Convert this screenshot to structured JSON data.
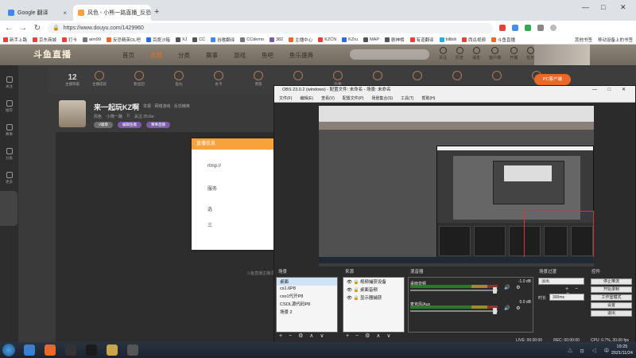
{
  "browser": {
    "tabs": [
      {
        "title": "Google 翻译",
        "favicon_color": "#4285f4"
      },
      {
        "title": "风色 - 小熊一路直播_反恐精英",
        "favicon_color": "#f7a23b"
      }
    ],
    "new_tab": "+",
    "window_controls": [
      "—",
      "□",
      "✕"
    ],
    "nav": {
      "back": "←",
      "forward": "→",
      "reload": "↻"
    },
    "url": "https://www.douyu.com/1429960",
    "bookmarks": [
      "新手上路",
      "京东商城",
      "打卡",
      "aim99",
      "反恐精英OL吧",
      "百度沙箱",
      "XJ",
      "CC",
      "谷歌翻译",
      "CCdemo",
      "382",
      "主播中心",
      "KZCN",
      "KZru",
      "MAP",
      "剧神榜",
      "有道翻译",
      "bilibili",
      "西瓜视频",
      "斗鱼直播"
    ],
    "bookmarks_right": [
      "其他书签",
      "移动设备上的书签"
    ]
  },
  "site": {
    "logo": "斗鱼直播",
    "nav": [
      "首页",
      "直播",
      "分类",
      "赛事",
      "游戏",
      "鱼吧",
      "鱼乐盛典"
    ],
    "active_nav": "直播",
    "header_icons": [
      "关注",
      "历史",
      "消息",
      "客户端",
      "开播",
      "任务"
    ],
    "stat_number": "12",
    "stat_label": "主播等级",
    "gifts": [
      "主播成就",
      "粉丝团",
      "鱼丸",
      "办卡",
      "贵族",
      "",
      "礼物",
      "",
      "",
      "",
      "",
      ""
    ],
    "pc_button": "PC客户端",
    "streamer_name": "来一起玩KZ啊",
    "streamer_meta": "举报 · 网络游戏 · 反恐精英",
    "streamer_row2": [
      "风色",
      "小熊一路",
      "0",
      "关注 25.6w"
    ],
    "tags": [
      "V徽章",
      "编辑鱼徽",
      "赛事直播"
    ],
    "left_rail": [
      "关注",
      "推荐",
      "赛事",
      "分类",
      "更多"
    ],
    "popup_title": "直播信息",
    "popup_lines": [
      "rtmp://",
      "服务",
      "选",
      "三"
    ],
    "footnote": "斗鱼直播主播须知"
  },
  "obs": {
    "title": "OBS 23.0.2 (windows) - 配置文件: 未命名 - 场景: 未命名",
    "menu": [
      "文件(F)",
      "编辑(E)",
      "查看(V)",
      "配置文件(P)",
      "场景集合(S)",
      "工具(T)",
      "帮助(H)"
    ],
    "scenes_label": "场景",
    "scenes": [
      "桌面",
      "cs1.6P8",
      "cso1代开P8",
      "CSOL源代码P8",
      "场景 2"
    ],
    "sources_label": "来源",
    "sources": [
      "视频捕获设备",
      "桌面音频",
      "显示器捕获"
    ],
    "mixer_label": "混音器",
    "mixer": [
      {
        "name": "桌面音频",
        "db": "-1.0 dB"
      },
      {
        "name": "麦克风/Aux",
        "db": "0.0 dB"
      }
    ],
    "transitions_label": "场景过渡",
    "transition": "淡出",
    "duration_label": "时长",
    "duration": "300ms",
    "controls_label": "控件",
    "controls": [
      "停止推流",
      "开始录制",
      "工作室模式",
      "设置",
      "退出"
    ],
    "status": [
      "LIVE: 00:00:00",
      "REC: 00:00:00",
      "CPU: 0.7%, 30.00 fps"
    ],
    "tools": "+ − ⚙ ∧ ∨"
  },
  "taskbar": {
    "time": "19:25",
    "date": "2021/11/24",
    "icon_colors": [
      "#3c7fd1",
      "#e8692a",
      "#333333",
      "#8b1e1e",
      "#1a1a1a",
      "#c9a64a",
      "#555555"
    ],
    "tray": "△ ⊡ ◁ 中"
  },
  "colors": {
    "douyu_orange": "#e8692a",
    "popup_header": "#f7a23b",
    "obs_bg": "#2b2b2b"
  }
}
